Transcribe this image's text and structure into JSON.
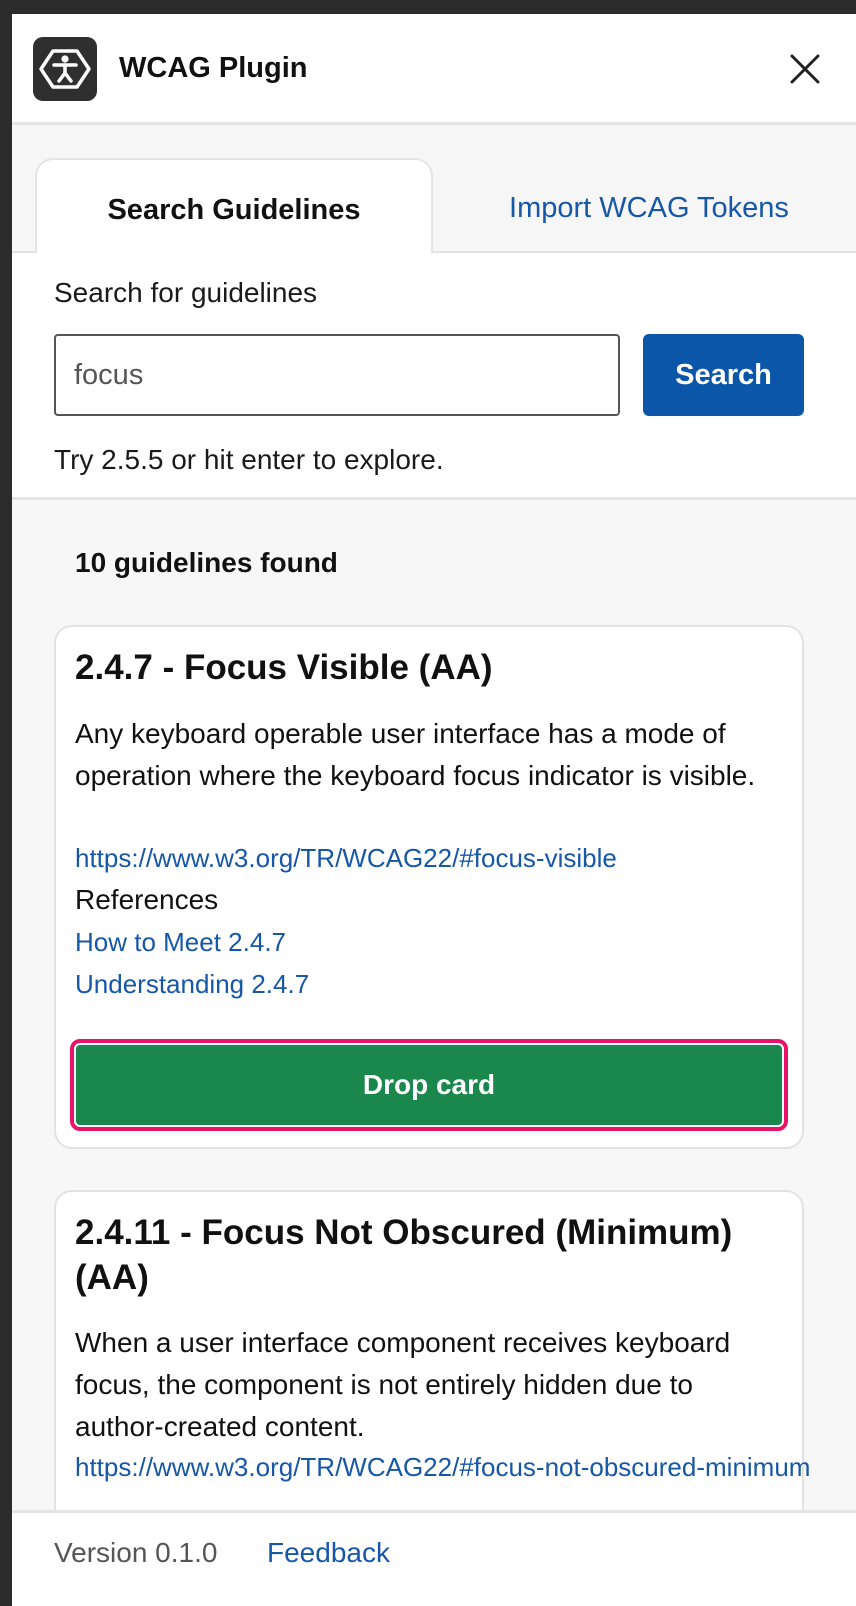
{
  "header": {
    "title": "WCAG Plugin",
    "logo_icon": "accessibility-person-icon",
    "close_icon": "close-icon"
  },
  "tabs": [
    {
      "label": "Search Guidelines",
      "active": true
    },
    {
      "label": "Import WCAG Tokens",
      "active": false
    }
  ],
  "search": {
    "label": "Search for guidelines",
    "value": "focus",
    "button_label": "Search",
    "hint": "Try 2.5.5 or hit enter to explore."
  },
  "results": {
    "count_text": "10 guidelines found",
    "cards": [
      {
        "title": "2.4.7 - Focus Visible (AA)",
        "description": "Any keyboard operable user interface has a mode of operation where the keyboard focus indicator is visible.",
        "url": "https://www.w3.org/TR/WCAG22/#focus-visible",
        "references_label": "References",
        "how_to_meet": "How to Meet 2.4.7",
        "understanding": "Understanding 2.4.7",
        "button_label": "Drop card"
      },
      {
        "title": "2.4.11 - Focus Not Obscured (Minimum) (AA)",
        "description": "When a user interface component receives keyboard focus, the component is not entirely hidden due to author-created content.",
        "url": "https://www.w3.org/TR/WCAG22/#focus-not-obscured-minimum"
      }
    ]
  },
  "footer": {
    "version": "Version 0.1.0",
    "feedback": "Feedback"
  },
  "colors": {
    "primary_blue": "#0b56a8",
    "link_blue": "#1757a8",
    "drop_green": "#1a874d",
    "focus_ring": "#e8146a"
  }
}
